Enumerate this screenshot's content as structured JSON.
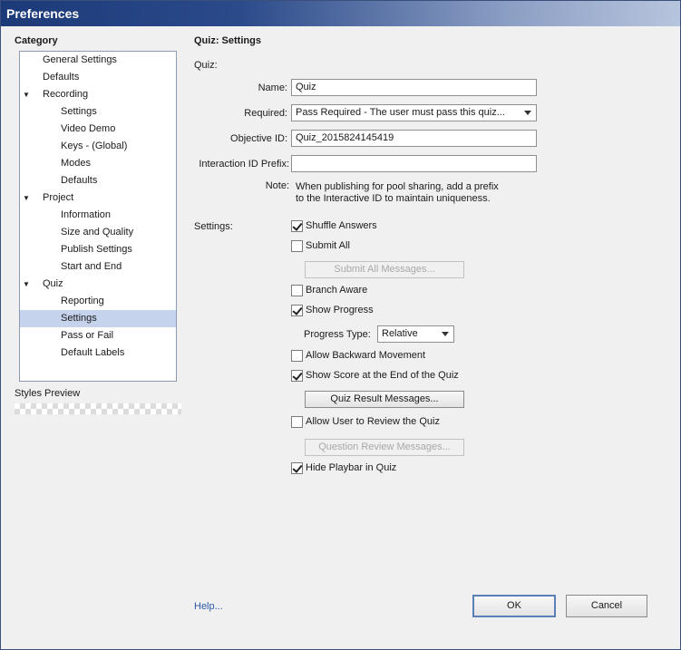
{
  "window": {
    "title": "Preferences"
  },
  "sidebar": {
    "category_label": "Category",
    "tree": [
      {
        "label": "General Settings",
        "level": 0,
        "arrow": false,
        "selected": false
      },
      {
        "label": "Defaults",
        "level": 0,
        "arrow": false,
        "selected": false
      },
      {
        "label": "Recording",
        "level": 0,
        "arrow": true,
        "selected": false
      },
      {
        "label": "Settings",
        "level": 1,
        "arrow": false,
        "selected": false
      },
      {
        "label": "Video Demo",
        "level": 1,
        "arrow": false,
        "selected": false
      },
      {
        "label": "Keys - (Global)",
        "level": 1,
        "arrow": false,
        "selected": false
      },
      {
        "label": "Modes",
        "level": 1,
        "arrow": false,
        "selected": false
      },
      {
        "label": "Defaults",
        "level": 1,
        "arrow": false,
        "selected": false
      },
      {
        "label": "Project",
        "level": 0,
        "arrow": true,
        "selected": false
      },
      {
        "label": "Information",
        "level": 1,
        "arrow": false,
        "selected": false
      },
      {
        "label": "Size and Quality",
        "level": 1,
        "arrow": false,
        "selected": false
      },
      {
        "label": "Publish Settings",
        "level": 1,
        "arrow": false,
        "selected": false
      },
      {
        "label": "Start and End",
        "level": 1,
        "arrow": false,
        "selected": false
      },
      {
        "label": "Quiz",
        "level": 0,
        "arrow": true,
        "selected": false
      },
      {
        "label": "Reporting",
        "level": 1,
        "arrow": false,
        "selected": false
      },
      {
        "label": "Settings",
        "level": 1,
        "arrow": false,
        "selected": true
      },
      {
        "label": "Pass or Fail",
        "level": 1,
        "arrow": false,
        "selected": false
      },
      {
        "label": "Default Labels",
        "level": 1,
        "arrow": false,
        "selected": false
      }
    ],
    "expand_glyph": "▼",
    "styles_preview_label": "Styles Preview"
  },
  "main": {
    "section_title": "Quiz: Settings",
    "quiz_group_label": "Quiz:",
    "name": {
      "label": "Name:",
      "value": "Quiz"
    },
    "required": {
      "label": "Required:",
      "value": "Pass Required - The user must pass this quiz..."
    },
    "objective_id": {
      "label": "Objective ID:",
      "value": "Quiz_2015824145419"
    },
    "interaction_prefix": {
      "label": "Interaction ID Prefix:",
      "value": ""
    },
    "note": {
      "label": "Note:",
      "line1": "When publishing for pool sharing, add a prefix",
      "line2": "to the Interactive ID to maintain uniqueness."
    },
    "settings_label": "Settings:",
    "checkboxes": {
      "shuffle_answers": {
        "label": "Shuffle Answers",
        "checked": true
      },
      "submit_all": {
        "label": "Submit All",
        "checked": false
      },
      "branch_aware": {
        "label": "Branch Aware",
        "checked": false
      },
      "show_progress": {
        "label": "Show Progress",
        "checked": true
      },
      "allow_backward": {
        "label": "Allow Backward Movement",
        "checked": false
      },
      "show_score": {
        "label": "Show Score at the End of the Quiz",
        "checked": true
      },
      "allow_review": {
        "label": "Allow User to Review the Quiz",
        "checked": false
      },
      "hide_playbar": {
        "label": "Hide Playbar in Quiz",
        "checked": true
      }
    },
    "buttons": {
      "submit_all_messages": "Submit All Messages...",
      "quiz_result_messages": "Quiz Result Messages...",
      "question_review_messages": "Question Review Messages..."
    },
    "progress_type": {
      "label": "Progress Type:",
      "value": "Relative"
    }
  },
  "footer": {
    "help": "Help...",
    "ok": "OK",
    "cancel": "Cancel"
  }
}
